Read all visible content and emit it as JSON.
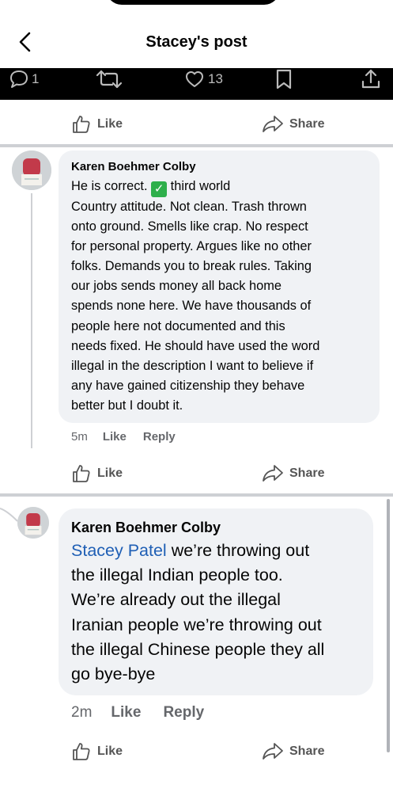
{
  "header": {
    "title": "Stacey's post"
  },
  "stats": {
    "comments": "1",
    "likes": "13"
  },
  "actions": {
    "like": "Like",
    "share": "Share"
  },
  "comments": [
    {
      "author": "Karen Boehmer Colby",
      "text_before_check": "He is correct. ",
      "text_after_check": " third world\nCountry attitude. Not clean. Trash thrown\nonto ground. Smells like crap. No respect\nfor personal property. Argues like no other\nfolks. Demands you to break rules. Taking\nour jobs sends money all back home\nspends none here. We have thousands of\npeople here not documented and this\nneeds fixed. He should have used the word\nillegal in the description I want to believe if\nany have gained citizenship they behave\nbetter but I doubt it.",
      "time": "5m",
      "like": "Like",
      "reply": "Reply"
    },
    {
      "author": "Karen Boehmer Colby",
      "mention": "Stacey Patel",
      "text": " we’re throwing out\nthe illegal Indian people too.\nWe’re already out the illegal\nIranian people we’re throwing out\nthe illegal Chinese people they all\ngo bye-bye",
      "time": "2m",
      "like": "Like",
      "reply": "Reply"
    }
  ]
}
